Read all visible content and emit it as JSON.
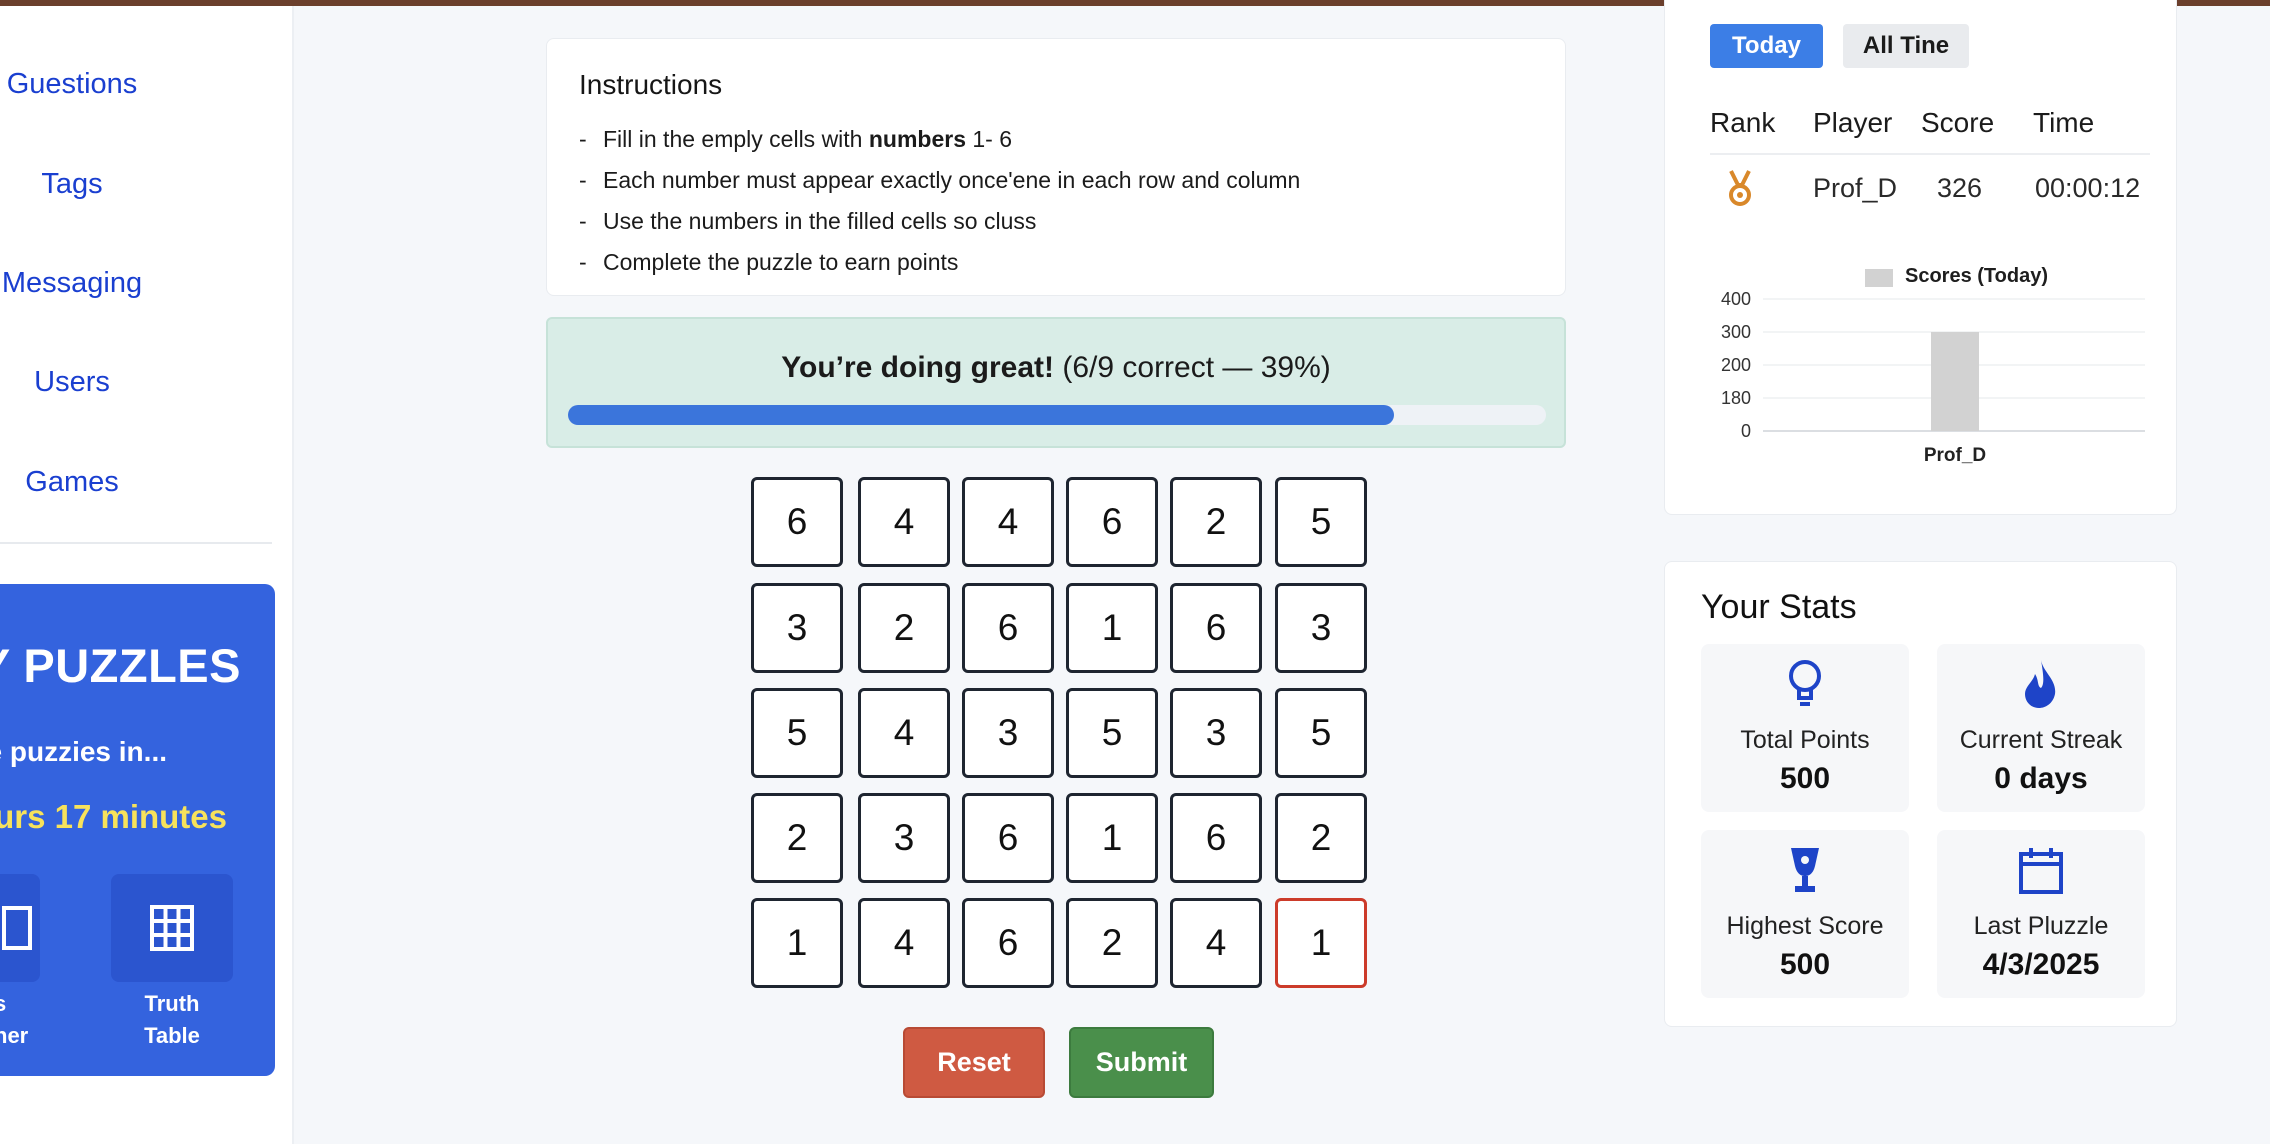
{
  "sidebar": {
    "items": [
      {
        "label": "Guestions"
      },
      {
        "label": "Tags"
      },
      {
        "label": "Messaging"
      },
      {
        "label": "Users"
      },
      {
        "label": "Games"
      }
    ],
    "promo": {
      "title": "LY PUZZLES",
      "subtitle": "e puzzies in...",
      "timer": "urs 17 minutes",
      "tiles": [
        {
          "label_line1": "s",
          "label_line2": "ner",
          "icon": "puzzle-icon"
        },
        {
          "label_line1": "Truth",
          "label_line2": "Table",
          "icon": "grid-icon"
        }
      ]
    }
  },
  "instructions": {
    "title": "Instructions",
    "items": [
      {
        "before": "Fill in the emply cells with ",
        "bold": "numbers",
        "after": " 1- 6"
      },
      {
        "before": "Each number must appear exactly once'ene in each row and column",
        "bold": "",
        "after": ""
      },
      {
        "before": "Use the numbers in the filled cells so cluss",
        "bold": "",
        "after": ""
      },
      {
        "before": "Complete the puzzle to earn points",
        "bold": "",
        "after": ""
      }
    ]
  },
  "progress": {
    "headline": "You’re doing great!",
    "detail": " (6/9 correct — 39%)",
    "fill_fraction": 0.845
  },
  "grid": {
    "rows": [
      [
        "6",
        "4",
        "4",
        "6",
        "2",
        "5"
      ],
      [
        "3",
        "2",
        "6",
        "1",
        "6",
        "3"
      ],
      [
        "5",
        "4",
        "3",
        "5",
        "3",
        "5"
      ],
      [
        "2",
        "3",
        "6",
        "1",
        "6",
        "2"
      ],
      [
        "1",
        "4",
        "6",
        "2",
        "4",
        "1"
      ]
    ],
    "error_cells": [
      [
        4,
        5
      ]
    ]
  },
  "buttons": {
    "reset": "Reset",
    "submit": "Submit"
  },
  "leaderboard": {
    "tabs": [
      "Today",
      "All Tine"
    ],
    "active_tab": "Today",
    "columns": [
      "Rank",
      "Player",
      "Score",
      "Time"
    ],
    "rows": [
      {
        "rank_icon": "medal-icon",
        "player": "Prof_D",
        "score": "326",
        "time": "00:00:12"
      }
    ]
  },
  "chart_data": {
    "type": "bar",
    "categories": [
      "Prof_D"
    ],
    "series": [
      {
        "name": "Scores (Today)",
        "values": [
          300
        ]
      }
    ],
    "title": "",
    "xlabel": "",
    "ylabel": "",
    "ylim": [
      0,
      400
    ],
    "yticks": [
      "0",
      "180",
      "200",
      "300",
      "400"
    ],
    "legend": "top",
    "grid": true,
    "colors": {
      "bar": "#d2d2d2"
    }
  },
  "stats": {
    "title": "Your Stats",
    "cards": [
      {
        "label": "Total Points",
        "value": "500",
        "icon": "lightbulb-icon"
      },
      {
        "label": "Current Streak",
        "value": "0 days",
        "icon": "flame-icon"
      },
      {
        "label": "Highest Score",
        "value": "500",
        "icon": "trophy-icon"
      },
      {
        "label": "Last Pluzzle",
        "value": "4/3/2025",
        "icon": "calendar-icon"
      }
    ]
  },
  "colors": {
    "accent": "#3c7ee6",
    "link": "#1a3fd0",
    "promo_bg": "#3463de",
    "success_bg": "#d9ede7",
    "reset": "#cf5a42",
    "submit": "#4a8f4b",
    "error_border": "#cc3b2a",
    "icon_blue": "#1e44c8"
  }
}
